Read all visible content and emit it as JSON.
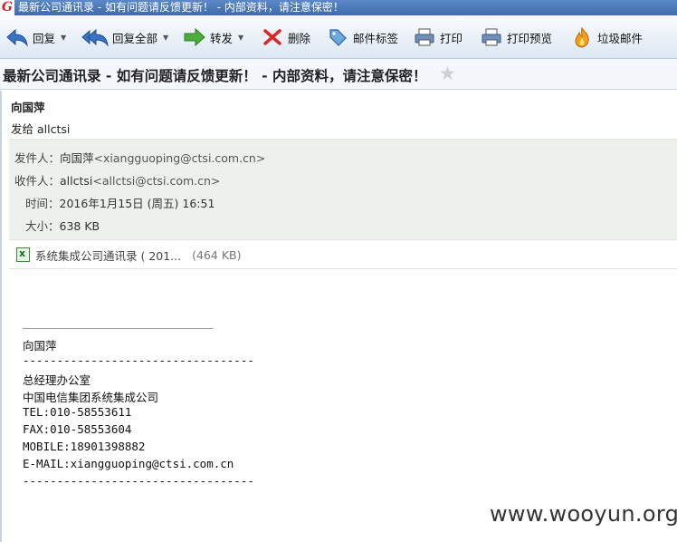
{
  "window": {
    "app_logo": "G",
    "title": "最新公司通讯录 - 如有问题请反馈更新！ - 内部资料，请注意保密！"
  },
  "toolbar": {
    "reply": "回复",
    "reply_all": "回复全部",
    "forward": "转发",
    "delete": "删除",
    "tag": "邮件标签",
    "print": "打印",
    "print_preview": "打印预览",
    "junk": "垃圾邮件",
    "dropdown_glyph": "▼"
  },
  "subject": {
    "text": "最新公司通讯录 - 如有问题请反馈更新！ - 内部资料，请注意保密！",
    "star": "★"
  },
  "message": {
    "sender_name": "向国萍",
    "sent_to": "发给 allctsi",
    "from_label": "发件人：",
    "from_name": "向国萍",
    "from_addr": "<xiangguoping@ctsi.com.cn>",
    "to_label": "收件人：",
    "to_name": "allctsi",
    "to_addr": "<allctsi@ctsi.com.cn>",
    "time_label": "时间：",
    "time_value": "2016年1月15日 (周五) 16:51",
    "size_label": "大小：",
    "size_value": "638 KB"
  },
  "attachment": {
    "name": "系统集成公司通讯录 ( 201...",
    "size": "(464 KB)"
  },
  "signature": {
    "name": "向国萍",
    "dashes": "----------------------------------",
    "dept": "总经理办公室",
    "company": "中国电信集团系统集成公司",
    "tel": "TEL:010-58553611",
    "fax": "FAX:010-58553604",
    "mobile": "MOBILE:18901398882",
    "email": "E-MAIL:xiangguoping@ctsi.com.cn"
  },
  "watermark": "www.wooyun.org",
  "colors": {
    "titlebar": "#4a78b8",
    "header_block": "#edf1ec",
    "brand_red": "#d62020"
  }
}
